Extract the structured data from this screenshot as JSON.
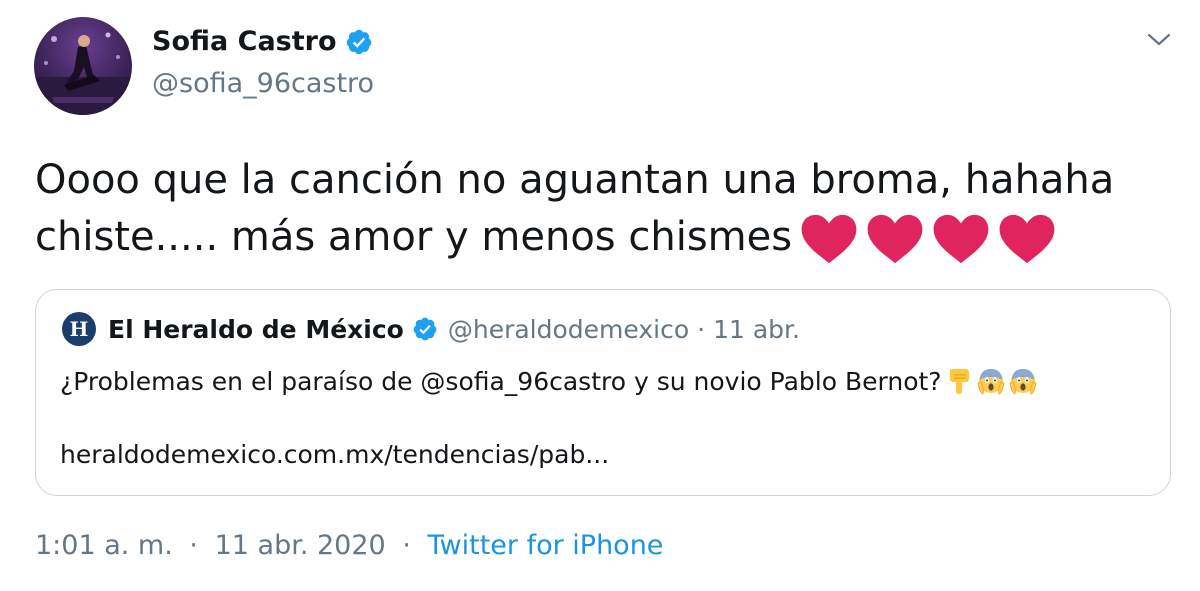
{
  "author": {
    "name": "Sofia Castro",
    "handle": "@sofia_96castro",
    "verified": true
  },
  "tweet": {
    "line1": "Oooo que la canción no aguantan una broma, hahaha",
    "line2": "chiste..... más amor y menos chismes",
    "emoji": [
      "red-heart",
      "red-heart",
      "red-heart",
      "red-heart"
    ]
  },
  "quoted": {
    "logo_letter": "H",
    "name": "El Heraldo de México",
    "handle": "@heraldodemexico",
    "separator": "·",
    "date": "11 abr.",
    "text": "¿Problemas en el paraíso de @sofia_96castro y su novio Pablo Bernot?",
    "emoji": [
      "backhand-index-pointing-down",
      "face-screaming-in-fear",
      "face-screaming-in-fear"
    ],
    "link": "heraldodemexico.com.mx/tendencias/pab..."
  },
  "footer": {
    "time": "1:01 a. m.",
    "separator1": "·",
    "date": "11 abr. 2020",
    "separator2": "·",
    "source": "Twitter for iPhone"
  },
  "colors": {
    "text": "#14171a",
    "muted": "#657786",
    "accent": "#1b95e0",
    "verified": "#1da1f2",
    "heart": "#e0245e"
  }
}
